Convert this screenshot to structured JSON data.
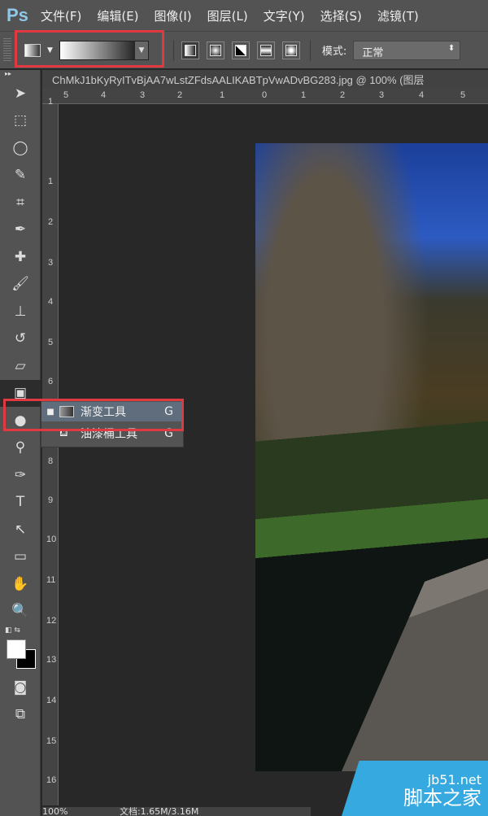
{
  "app": {
    "logo": "Ps"
  },
  "menu": [
    "文件(F)",
    "编辑(E)",
    "图像(I)",
    "图层(L)",
    "文字(Y)",
    "选择(S)",
    "滤镜(T)"
  ],
  "options": {
    "mode_label": "模式:",
    "mode_value": "正常",
    "gradient_types": [
      "linear",
      "radial",
      "angle",
      "reflected",
      "diamond"
    ]
  },
  "document": {
    "tab_title": "ChMkJ1bKyRyITvBjAA7wLstZFdsAALIKABTpVwADvBG283.jpg @ 100% (图层"
  },
  "rulers": {
    "horizontal": [
      "5",
      "4",
      "3",
      "2",
      "1",
      "0",
      "1",
      "2",
      "3",
      "4",
      "5"
    ],
    "vertical": [
      "1",
      "1",
      "2",
      "3",
      "4",
      "5",
      "6",
      "7",
      "8",
      "9",
      "10",
      "11",
      "12",
      "13",
      "14",
      "15",
      "16"
    ]
  },
  "tools": [
    {
      "name": "move",
      "glyph": "➤"
    },
    {
      "name": "marquee",
      "glyph": "⬚"
    },
    {
      "name": "lasso",
      "glyph": "◯"
    },
    {
      "name": "quick-select",
      "glyph": "✎"
    },
    {
      "name": "crop",
      "glyph": "⌗"
    },
    {
      "name": "eyedropper",
      "glyph": "✒"
    },
    {
      "name": "healing",
      "glyph": "✚"
    },
    {
      "name": "brush",
      "glyph": "🖌"
    },
    {
      "name": "stamp",
      "glyph": "⊥"
    },
    {
      "name": "history-brush",
      "glyph": "↺"
    },
    {
      "name": "eraser",
      "glyph": "▱"
    },
    {
      "name": "gradient",
      "glyph": "▣"
    },
    {
      "name": "blur",
      "glyph": "●"
    },
    {
      "name": "dodge",
      "glyph": "⚲"
    },
    {
      "name": "pen",
      "glyph": "✑"
    },
    {
      "name": "type",
      "glyph": "T"
    },
    {
      "name": "path-select",
      "glyph": "↖"
    },
    {
      "name": "rectangle",
      "glyph": "▭"
    },
    {
      "name": "hand",
      "glyph": "✋"
    },
    {
      "name": "zoom",
      "glyph": "🔍"
    }
  ],
  "flyout": [
    {
      "label": "渐变工具",
      "key": "G",
      "selected": true
    },
    {
      "label": "油漆桶工具",
      "key": "G",
      "selected": false
    }
  ],
  "status": {
    "zoom": "100%",
    "doc": "文档:1.65M/3.16M"
  },
  "watermark": {
    "url": "jb51.net",
    "name": "脚本之家"
  },
  "colors": {
    "highlight": "#e0393f",
    "watermark": "#35a9e0"
  }
}
